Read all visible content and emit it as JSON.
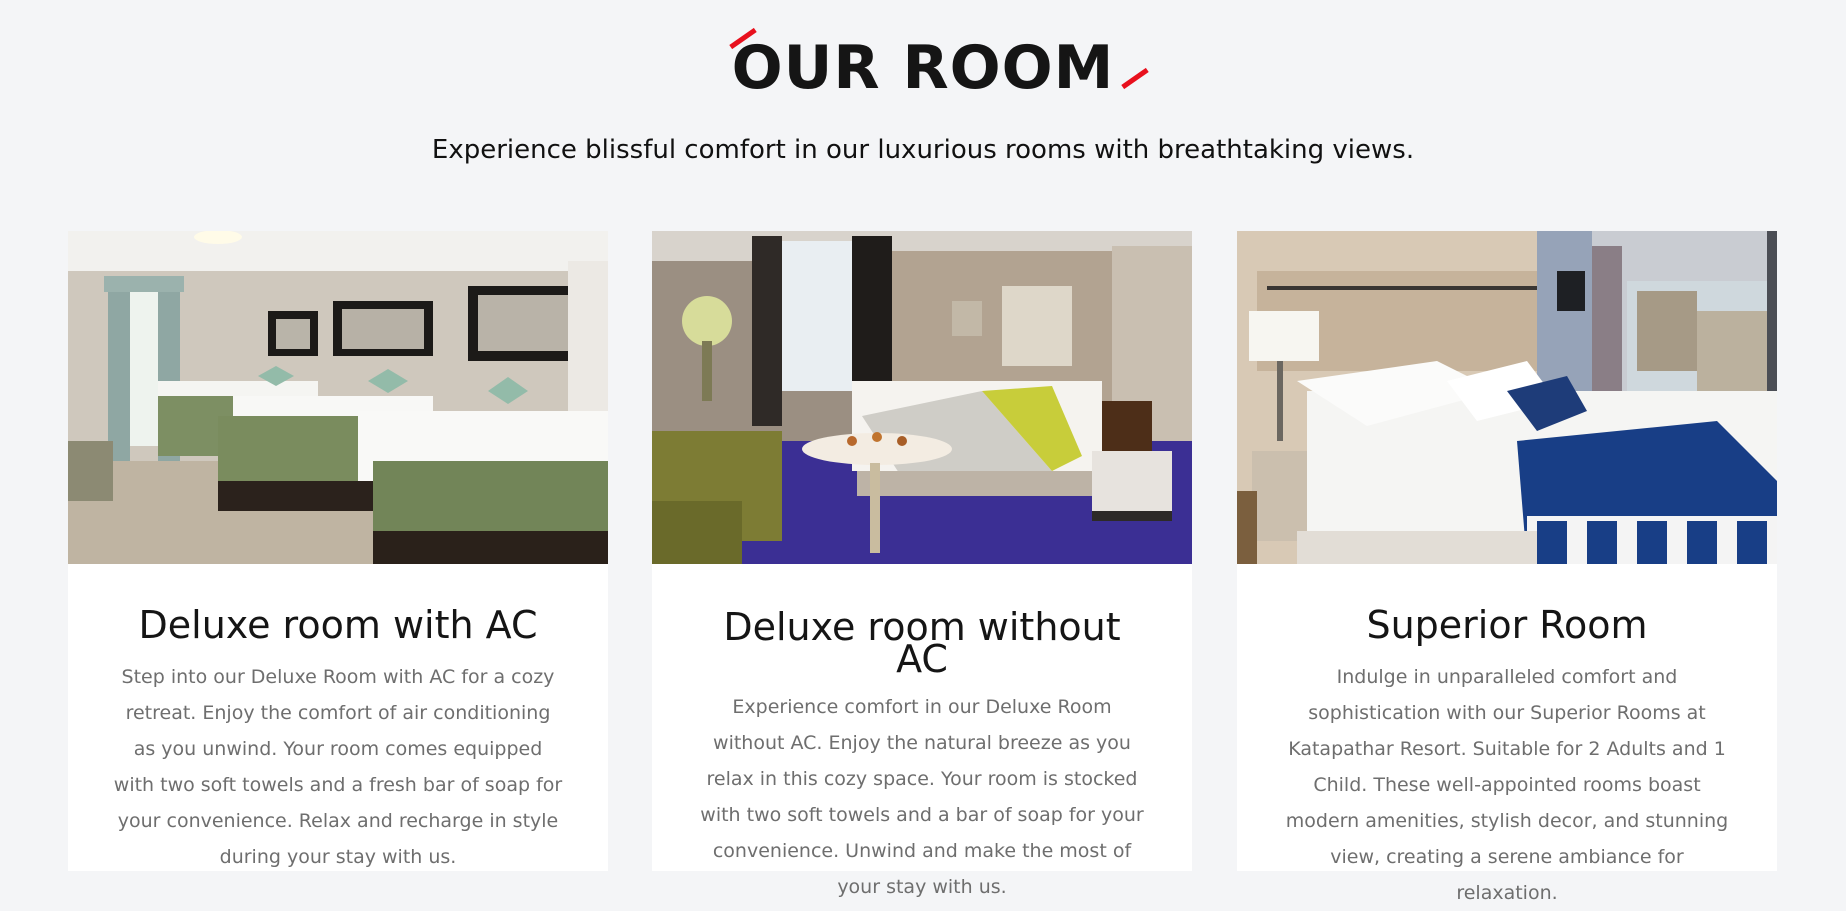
{
  "section": {
    "title": "OUR ROOM",
    "subtitle": "Experience blissful comfort in our luxurious rooms with breathtaking views.",
    "accent_color": "#e8101d"
  },
  "rooms": [
    {
      "name": "Deluxe room with AC",
      "description": "Step into our Deluxe Room with AC for a cozy retreat. Enjoy the comfort of air conditioning as you unwind. Your room comes equipped with two soft towels and a fresh bar of soap for your convenience. Relax and recharge in style during your stay with us."
    },
    {
      "name": "Deluxe room without AC",
      "description": "Experience comfort in our Deluxe Room without AC. Enjoy the natural breeze as you relax in this cozy space. Your room is stocked with two soft towels and a bar of soap for your convenience. Unwind and make the most of your stay with us."
    },
    {
      "name": "Superior Room",
      "description": "Indulge in unparalleled comfort and sophistication with our Superior Rooms at Katapathar Resort. Suitable for 2 Adults and 1 Child. These well-appointed rooms boast modern amenities, stylish decor, and stunning view, creating a serene ambiance for relaxation."
    }
  ]
}
